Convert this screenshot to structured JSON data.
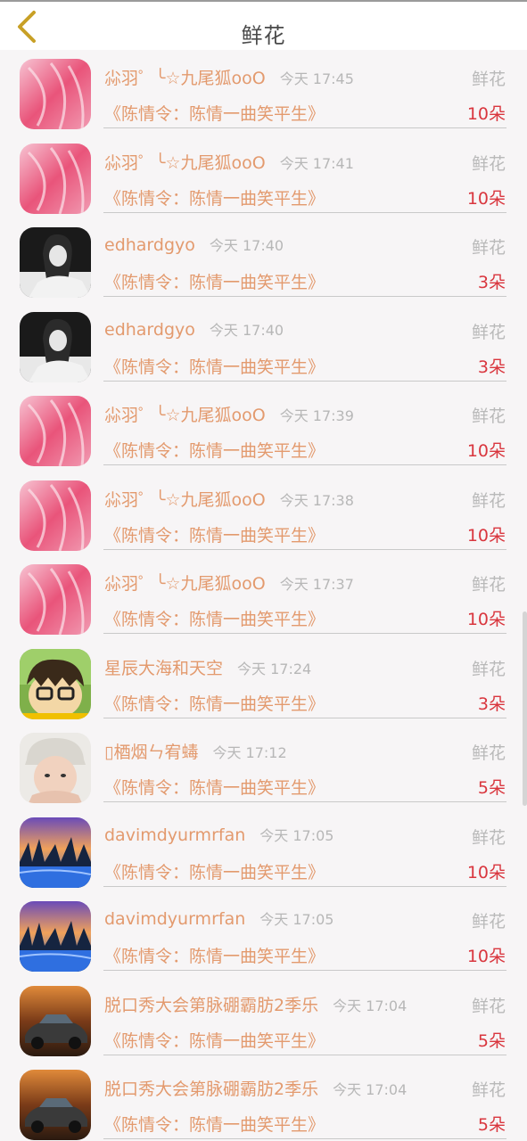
{
  "header": {
    "title": "鲜花"
  },
  "gifts": [
    {
      "user": "尛羽゜╰☆九尾狐ooO",
      "time": "今天 17:45",
      "type": "鲜花",
      "book": "《陈情令：陈情一曲笑平生》",
      "count": "10朵",
      "avatar": "pink-avatar"
    },
    {
      "user": "尛羽゜╰☆九尾狐ooO",
      "time": "今天 17:41",
      "type": "鲜花",
      "book": "《陈情令：陈情一曲笑平生》",
      "count": "10朵",
      "avatar": "pink-avatar"
    },
    {
      "user": "edhardgyo",
      "time": "今天 17:40",
      "type": "鲜花",
      "book": "《陈情令：陈情一曲笑平生》",
      "count": "3朵",
      "avatar": "bw-avatar"
    },
    {
      "user": "edhardgyo",
      "time": "今天 17:40",
      "type": "鲜花",
      "book": "《陈情令：陈情一曲笑平生》",
      "count": "3朵",
      "avatar": "bw-avatar"
    },
    {
      "user": "尛羽゜╰☆九尾狐ooO",
      "time": "今天 17:39",
      "type": "鲜花",
      "book": "《陈情令：陈情一曲笑平生》",
      "count": "10朵",
      "avatar": "pink-avatar"
    },
    {
      "user": "尛羽゜╰☆九尾狐ooO",
      "time": "今天 17:38",
      "type": "鲜花",
      "book": "《陈情令：陈情一曲笑平生》",
      "count": "10朵",
      "avatar": "pink-avatar"
    },
    {
      "user": "尛羽゜╰☆九尾狐ooO",
      "time": "今天 17:37",
      "type": "鲜花",
      "book": "《陈情令：陈情一曲笑平生》",
      "count": "10朵",
      "avatar": "pink-avatar"
    },
    {
      "user": "星辰大海和天空",
      "time": "今天 17:24",
      "type": "鲜花",
      "book": "《陈情令：陈情一曲笑平生》",
      "count": "3朵",
      "avatar": "cartoon-avatar"
    },
    {
      "user": "▯梄烟ㄣ宥蝳",
      "time": "今天 17:12",
      "type": "鲜花",
      "book": "《陈情令：陈情一曲笑平生》",
      "count": "5朵",
      "avatar": "child-avatar"
    },
    {
      "user": "davimdyurmrfan",
      "time": "今天 17:05",
      "type": "鲜花",
      "book": "《陈情令：陈情一曲笑平生》",
      "count": "10朵",
      "avatar": "landscape-avatar"
    },
    {
      "user": "davimdyurmrfan",
      "time": "今天 17:05",
      "type": "鲜花",
      "book": "《陈情令：陈情一曲笑平生》",
      "count": "10朵",
      "avatar": "landscape-avatar"
    },
    {
      "user": "脱口秀大会第脉硼霸肪2季乐",
      "time": "今天 17:04",
      "type": "鲜花",
      "book": "《陈情令：陈情一曲笑平生》",
      "count": "5朵",
      "avatar": "car-avatar"
    },
    {
      "user": "脱口秀大会第脉硼霸肪2季乐",
      "time": "今天 17:04",
      "type": "鲜花",
      "book": "《陈情令：陈情一曲笑平生》",
      "count": "5朵",
      "avatar": "car-avatar"
    }
  ],
  "colors": {
    "accent": "#e39a6e",
    "count": "#d9363e",
    "back_arrow": "#c8a026"
  }
}
